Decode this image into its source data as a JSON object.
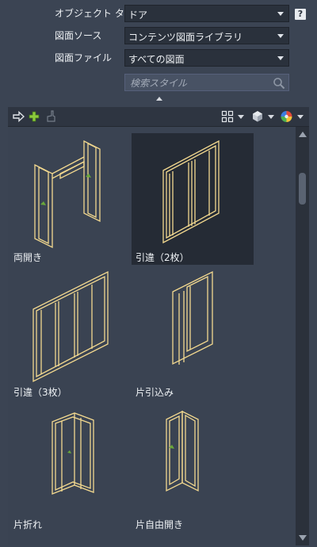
{
  "form": {
    "object_type": {
      "label": "オブジェクト タイプ",
      "value": "ドア"
    },
    "drawing_source": {
      "label": "図面ソース",
      "value": "コンテンツ図面ライブラリ"
    },
    "drawing_file": {
      "label": "図面ファイル",
      "value": "すべての図面"
    },
    "search": {
      "placeholder": "検索スタイル"
    },
    "help_label": "?"
  },
  "toolbar": {
    "icons": [
      "import-arrow-icon",
      "add-plus-icon",
      "purge-brush-icon",
      "view-grid-icon",
      "display-style-icon",
      "color-wheel-icon"
    ]
  },
  "library": {
    "items": [
      {
        "label": "両開き",
        "selected": false
      },
      {
        "label": "引違（2枚）",
        "selected": true
      },
      {
        "label": "引違（3枚）",
        "selected": false
      },
      {
        "label": "片引込み",
        "selected": false
      },
      {
        "label": "片折れ",
        "selected": false
      },
      {
        "label": "片自由開き",
        "selected": false
      }
    ]
  },
  "colors": {
    "accent_line": "#f3d98f",
    "handle": "#6aa83a",
    "selected_tile": "#252b35"
  }
}
